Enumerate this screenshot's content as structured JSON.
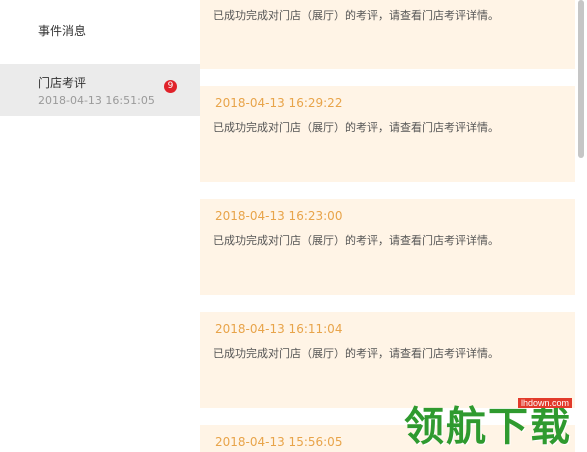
{
  "sidebar": {
    "events": {
      "label": "事件消息"
    },
    "store_review": {
      "label": "门店考评",
      "time": "2018-04-13 16:51:05",
      "badge": "9"
    }
  },
  "messages": [
    {
      "time": "",
      "text": "已成功完成对门店（展厅）的考评，请查看门店考评详情。"
    },
    {
      "time": "2018-04-13 16:29:22",
      "text": "已成功完成对门店（展厅）的考评，请查看门店考评详情。"
    },
    {
      "time": "2018-04-13 16:23:00",
      "text": "已成功完成对门店（展厅）的考评，请查看门店考评详情。"
    },
    {
      "time": "2018-04-13 16:11:04",
      "text": "已成功完成对门店（展厅）的考评，请查看门店考评详情。"
    },
    {
      "time": "2018-04-13 15:56:05",
      "text": ""
    }
  ],
  "watermark": {
    "url": "lhdown.com",
    "text": "领航下载"
  },
  "colors": {
    "card_bg": "#fff4e6",
    "time_text": "#e8a44a",
    "badge": "#e0222a",
    "selected_item": "#ebebeb"
  }
}
